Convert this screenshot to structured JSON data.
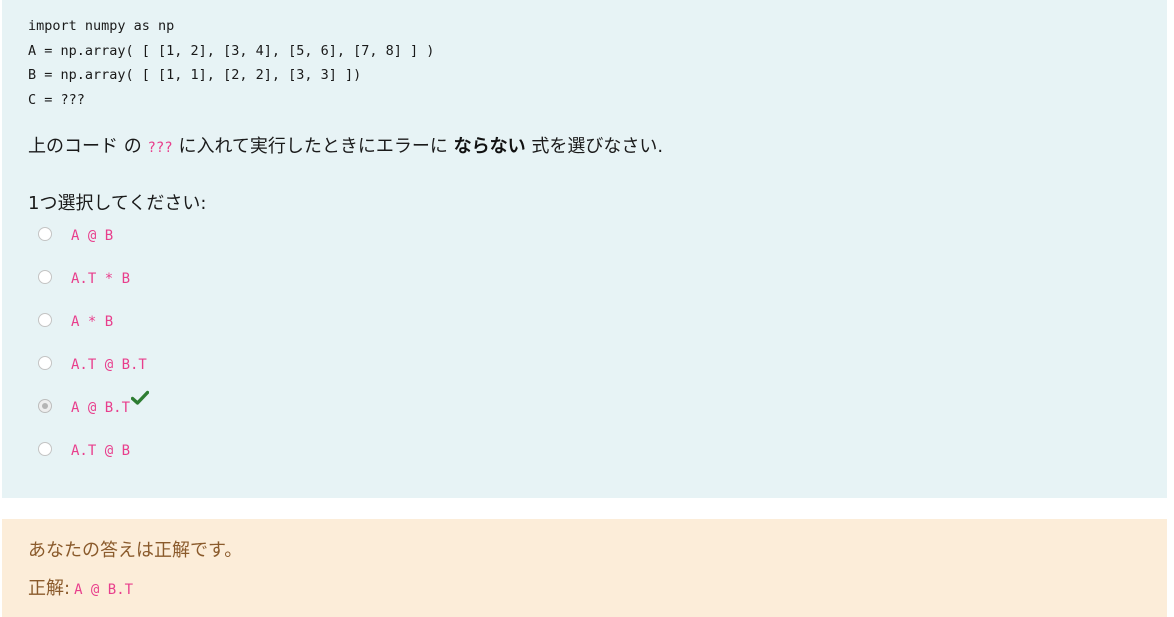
{
  "question": {
    "code_lines": [
      "import numpy as np",
      "A = np.array( [ [1, 2], [3, 4], [5, 6], [7, 8] ] )",
      "B = np.array( [ [1, 1], [2, 2], [3, 3] ])",
      "C = ???"
    ],
    "prompt": {
      "before": "上のコード の ",
      "placeholder": "???",
      "middle": " に入れて実行したときにエラーに ",
      "emphasis": "ならない",
      "after": " 式を選びなさい."
    },
    "select_label": "1つ選択してください:",
    "options": [
      {
        "text": "A @ B",
        "selected": false
      },
      {
        "text": "A.T * B",
        "selected": false
      },
      {
        "text": "A * B",
        "selected": false
      },
      {
        "text": "A.T @ B.T",
        "selected": false
      },
      {
        "text": "A @ B.T",
        "selected": true,
        "correct_mark": "check-icon"
      },
      {
        "text": "A.T @ B",
        "selected": false
      }
    ]
  },
  "feedback": {
    "message": "あなたの答えは正解です。",
    "right_answer_label": "正解:",
    "right_answer_value": "A @ B.T"
  },
  "colors": {
    "question_bg": "#e7f3f5",
    "feedback_bg": "#fcedd9",
    "code_accent": "#e83e8c",
    "feedback_text": "#8a5a2b",
    "check_green": "#2e7d32"
  }
}
